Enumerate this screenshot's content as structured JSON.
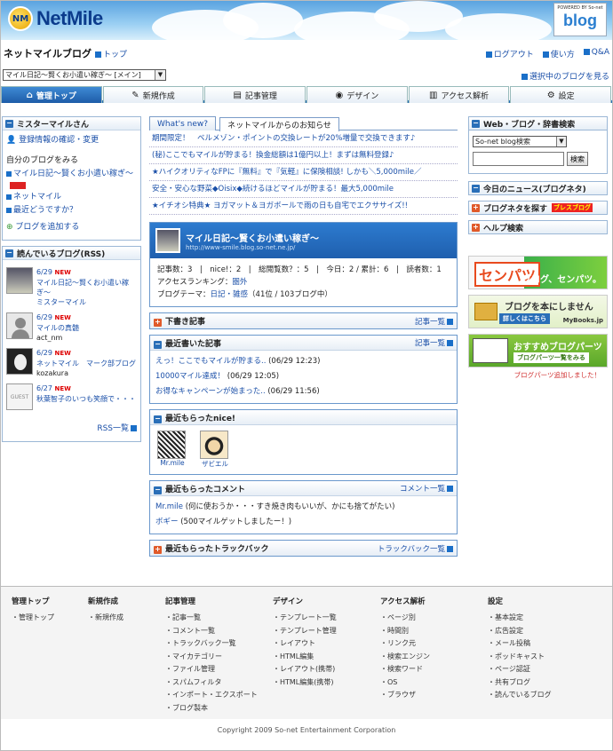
{
  "header": {
    "logo_text": "NetMile",
    "logo_mark": "NM",
    "badge_powered": "POWERED BY So-net",
    "badge_blog": "blog"
  },
  "titlebar": {
    "site_title": "ネットマイルブログ",
    "top_link": "トップ",
    "util": [
      "ログアウト",
      "使い方",
      "Q&A"
    ]
  },
  "blog_selector": {
    "value": "マイル日記〜賢くお小遣い稼ぎ〜 [メイン]",
    "link": "選択中のブログを見る"
  },
  "tabs": [
    {
      "label": "管理トップ",
      "icon": "home-icon"
    },
    {
      "label": "新規作成",
      "icon": "pencil-icon"
    },
    {
      "label": "記事管理",
      "icon": "document-icon"
    },
    {
      "label": "デザイン",
      "icon": "palette-icon"
    },
    {
      "label": "アクセス解析",
      "icon": "bar-chart-icon"
    },
    {
      "label": "設定",
      "icon": "gear-icon"
    }
  ],
  "left": {
    "user_head": "ミスターマイルさん",
    "user_link": "登録情報の確認・変更",
    "myblogs_title": "自分のブログをみる",
    "myblogs": [
      "マイル日記〜賢くお小遣い稼ぎ〜",
      "ネットマイル",
      "最近どうですか？"
    ],
    "add_blog": "ブログを追加する",
    "rss_head": "読んでいるブログ(RSS)",
    "rss_items": [
      {
        "date": "6/29",
        "new": "NEW",
        "title": "マイル日記〜賢くお小遣い稼ぎ〜",
        "author": "ミスターマイル"
      },
      {
        "date": "6/29",
        "new": "NEW",
        "title": "マイルの真髄",
        "author": "act_nm"
      },
      {
        "date": "6/29",
        "new": "NEW",
        "title": "ネットマイル　マーク部ブログ",
        "author": "kozakura"
      },
      {
        "date": "6/27",
        "new": "NEW",
        "title": "秋葉智子のいつも笑顔で・・・",
        "author": ""
      }
    ],
    "rss_more": "RSS一覧"
  },
  "center": {
    "notice_tabs": [
      "What's new?",
      "ネットマイルからのお知らせ"
    ],
    "news": [
      "期間限定！　ベルメゾン・ポイントの交換レートが20%増量で交換できます♪",
      "(秘)ここでもマイルが貯まる！換金総額は1億円以上！まずは無料登録♪",
      "★ハイクオリティなFPに『無料』で『気軽』に保険相談! しかも＼5,000mile／",
      "安全・安心な野菜◆Oisix◆続けるほどマイルが貯まる！最大5,000mile",
      "★イチオシ特典★ ヨガマット＆ヨガボールで雨の日も自宅でエクササイズ!!"
    ],
    "blog_card": {
      "title": "マイル日記〜賢くお小遣い稼ぎ〜",
      "url": "http://www-smile.blog.so-net.ne.jp/",
      "stats": "記事数：3　|　nice!：2　|　総閲覧数？：5　|　今日：2 / 累計：6　|　読者数：1",
      "ranking_label": "アクセスランキング：",
      "ranking_value": "圏外",
      "genre_label": "ブログテーマ：",
      "genre_value": "日記・雑感",
      "genre_rank": "（41位 / 103ブログ中）"
    },
    "drafts": {
      "title": "下書き記事",
      "more": "記事一覧"
    },
    "recent_posts": {
      "title": "最近書いた記事",
      "more": "記事一覧",
      "items": [
        {
          "title": "えっ！ここでもマイルが貯まる..",
          "time": "(06/29 12:23)"
        },
        {
          "title": "10000マイル達成！",
          "time": "(06/29 12:05)"
        },
        {
          "title": "お得なキャンペーンが始まった..",
          "time": "(06/29 11:56)"
        }
      ]
    },
    "nice": {
      "title": "最近もらったnice!",
      "items": [
        "Mr.mile",
        "ザビエル"
      ]
    },
    "comments": {
      "title": "最近もらったコメント",
      "more": "コメント一覧",
      "items": [
        {
          "author": "Mr.mile",
          "text": "(何に使おうか・・・すき焼き肉もいいが、かにも捨てがたい)"
        },
        {
          "author": "ボギー",
          "text": "(500マイルゲットしましたー！)"
        }
      ]
    },
    "trackback": {
      "title": "最近もらったトラックバック",
      "more": "トラックバック一覧"
    }
  },
  "right": {
    "search_head": "Web・ブログ・辞書検索",
    "engine": "So-net blog検索",
    "search_value": "",
    "search_btn": "検索",
    "news_head": "今日のニュース(ブログネタ)",
    "neta_head": "ブログネタを探す",
    "neta_badge": "ブレスブログ",
    "help_head": "ヘルプ検索",
    "banner1_logo": "センパツ",
    "banner1_text": "ブログ、センパツ。",
    "banner2_text": "ブログを本にしませんか?",
    "banner2_sub": "詳しくはこちら",
    "banner2_brand": "MyBooks.jp",
    "banner3_text": "おすすめブログパーツ",
    "banner3_sub": "ブログパーツ一覧をみる",
    "parts_note": "ブログパーツ追加しました！"
  },
  "footer": {
    "columns": [
      {
        "head": "管理トップ",
        "items": [
          "管理トップ"
        ]
      },
      {
        "head": "新規作成",
        "items": [
          "新規作成"
        ]
      },
      {
        "head": "記事管理",
        "items": [
          "記事一覧",
          "コメント一覧",
          "トラックバック一覧",
          "マイカテゴリー",
          "ファイル管理",
          "スパムフィルタ",
          "インポート・エクスポート",
          "ブログ製本"
        ]
      },
      {
        "head": "デザイン",
        "items": [
          "テンプレート一覧",
          "テンプレート管理",
          "レイアウト",
          "HTML編集",
          "レイアウト(携帯)",
          "HTML編集(携帯)"
        ]
      },
      {
        "head": "アクセス解析",
        "items": [
          "ページ別",
          "時間別",
          "リンク元",
          "検索エンジン",
          "検索ワード",
          "OS",
          "ブラウザ"
        ]
      },
      {
        "head": "設定",
        "items": [
          "基本設定",
          "広告設定",
          "メール投稿",
          "ポッドキャスト",
          "ページ認証",
          "共有ブログ",
          "読んでいるブログ"
        ]
      }
    ],
    "copyright": "Copyright 2009 So-net Entertainment Corporation"
  },
  "colors": {
    "accent": "#1f5fae",
    "link": "#1a4fa8",
    "new_badge": "#dd0000"
  }
}
